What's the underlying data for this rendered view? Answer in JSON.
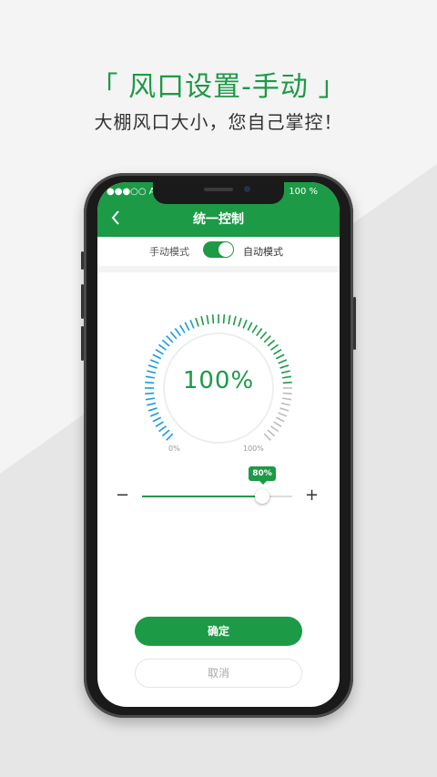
{
  "promo": {
    "headline": "「 风口设置-手动 」",
    "subline": "大棚风口大小，您自己掌控！"
  },
  "status_bar": {
    "carrier": "●●●○○ Apple",
    "battery": "100 %"
  },
  "nav": {
    "back_icon": "back-chevron-icon",
    "title": "统一控制"
  },
  "mode": {
    "manual_label": "手动模式",
    "auto_label": "自动模式",
    "toggle_on": true
  },
  "gauge": {
    "value_text": "100%",
    "min_label": "0%",
    "max_label": "100%",
    "level": 1.0
  },
  "slider": {
    "value": 0.8,
    "tooltip": "80%",
    "minus_label": "−",
    "plus_label": "+"
  },
  "actions": {
    "confirm_label": "确定",
    "cancel_label": "取消"
  },
  "colors": {
    "primary": "#1c9a46",
    "tick_blue": "#1a9be0",
    "tick_grey": "#bdbdbd"
  }
}
